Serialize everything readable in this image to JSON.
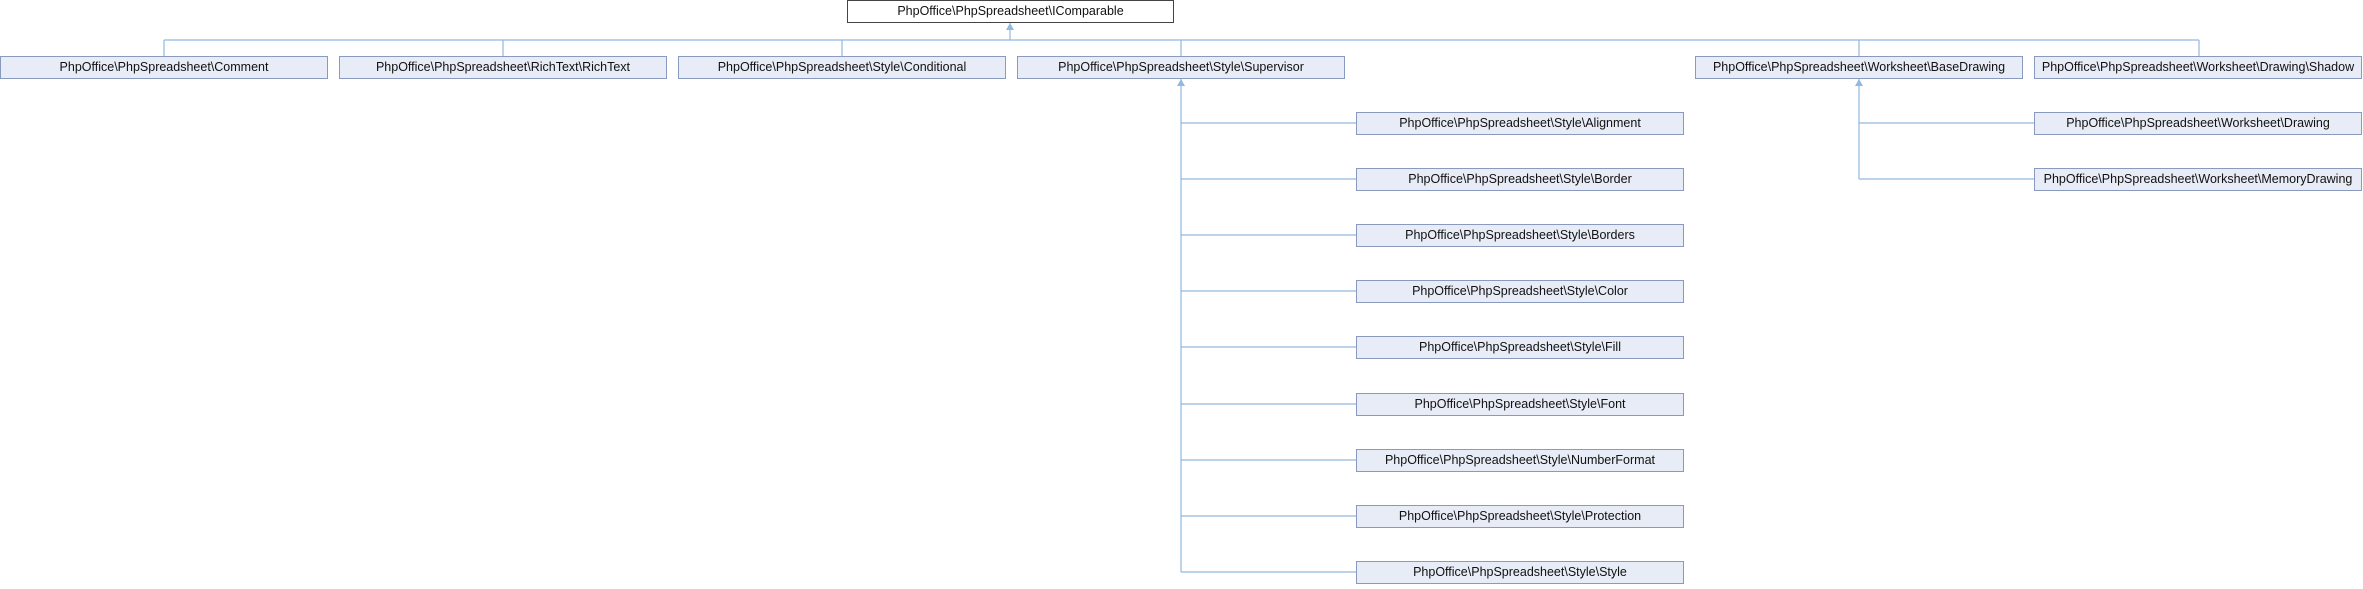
{
  "root": {
    "label": "PhpOffice\\PhpSpreadsheet\\IComparable"
  },
  "level1": [
    {
      "label": "PhpOffice\\PhpSpreadsheet\\Comment"
    },
    {
      "label": "PhpOffice\\PhpSpreadsheet\\RichText\\RichText"
    },
    {
      "label": "PhpOffice\\PhpSpreadsheet\\Style\\Conditional"
    },
    {
      "label": "PhpOffice\\PhpSpreadsheet\\Style\\Supervisor"
    },
    {
      "label": "PhpOffice\\PhpSpreadsheet\\Worksheet\\BaseDrawing"
    },
    {
      "label": "PhpOffice\\PhpSpreadsheet\\Worksheet\\Drawing\\Shadow"
    }
  ],
  "supervisor_children": [
    {
      "label": "PhpOffice\\PhpSpreadsheet\\Style\\Alignment"
    },
    {
      "label": "PhpOffice\\PhpSpreadsheet\\Style\\Border"
    },
    {
      "label": "PhpOffice\\PhpSpreadsheet\\Style\\Borders"
    },
    {
      "label": "PhpOffice\\PhpSpreadsheet\\Style\\Color"
    },
    {
      "label": "PhpOffice\\PhpSpreadsheet\\Style\\Fill"
    },
    {
      "label": "PhpOffice\\PhpSpreadsheet\\Style\\Font"
    },
    {
      "label": "PhpOffice\\PhpSpreadsheet\\Style\\NumberFormat"
    },
    {
      "label": "PhpOffice\\PhpSpreadsheet\\Style\\Protection"
    },
    {
      "label": "PhpOffice\\PhpSpreadsheet\\Style\\Style"
    }
  ],
  "basedrawing_children": [
    {
      "label": "PhpOffice\\PhpSpreadsheet\\Worksheet\\Drawing"
    },
    {
      "label": "PhpOffice\\PhpSpreadsheet\\Worksheet\\MemoryDrawing"
    }
  ],
  "colors": {
    "edge": "#90b8e0",
    "node_fill": "#e8ecf6",
    "node_border": "#8a9abf",
    "root_border": "#444444"
  }
}
